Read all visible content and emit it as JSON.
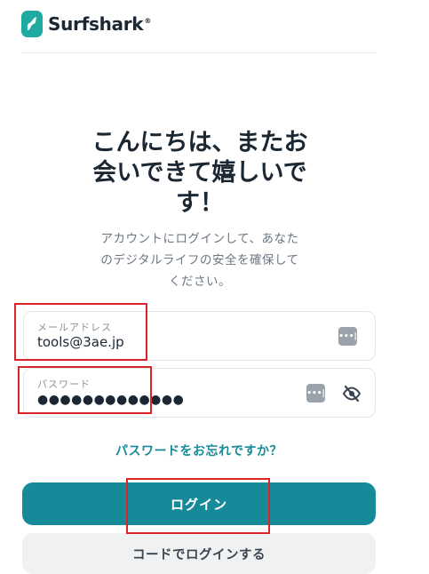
{
  "brand": {
    "name": "Surfshark",
    "reg_mark": "®",
    "color": "#1eaaa0"
  },
  "main": {
    "heading_lines": [
      "こんにちは、またお",
      "会いできて嬉しいで",
      "す！"
    ],
    "subtext_lines": [
      "アカウントにログインして、あなた",
      "のデジタルライフの安全を確保して",
      "ください。"
    ]
  },
  "form": {
    "email": {
      "label": "メールアドレス",
      "value": "tools@3ae.jp",
      "icon": "password-manager-icon"
    },
    "password": {
      "label": "パスワード",
      "value": "●●●●●●●●●●●●●",
      "icon": "password-manager-icon",
      "toggle_icon": "eye-slash-icon"
    },
    "forgot_link": "パスワードをお忘れですか？",
    "login_button": "ログイン",
    "code_login_button": "コードでログインする"
  },
  "colors": {
    "accent": "#178a99",
    "annotation": "#d9242a"
  }
}
